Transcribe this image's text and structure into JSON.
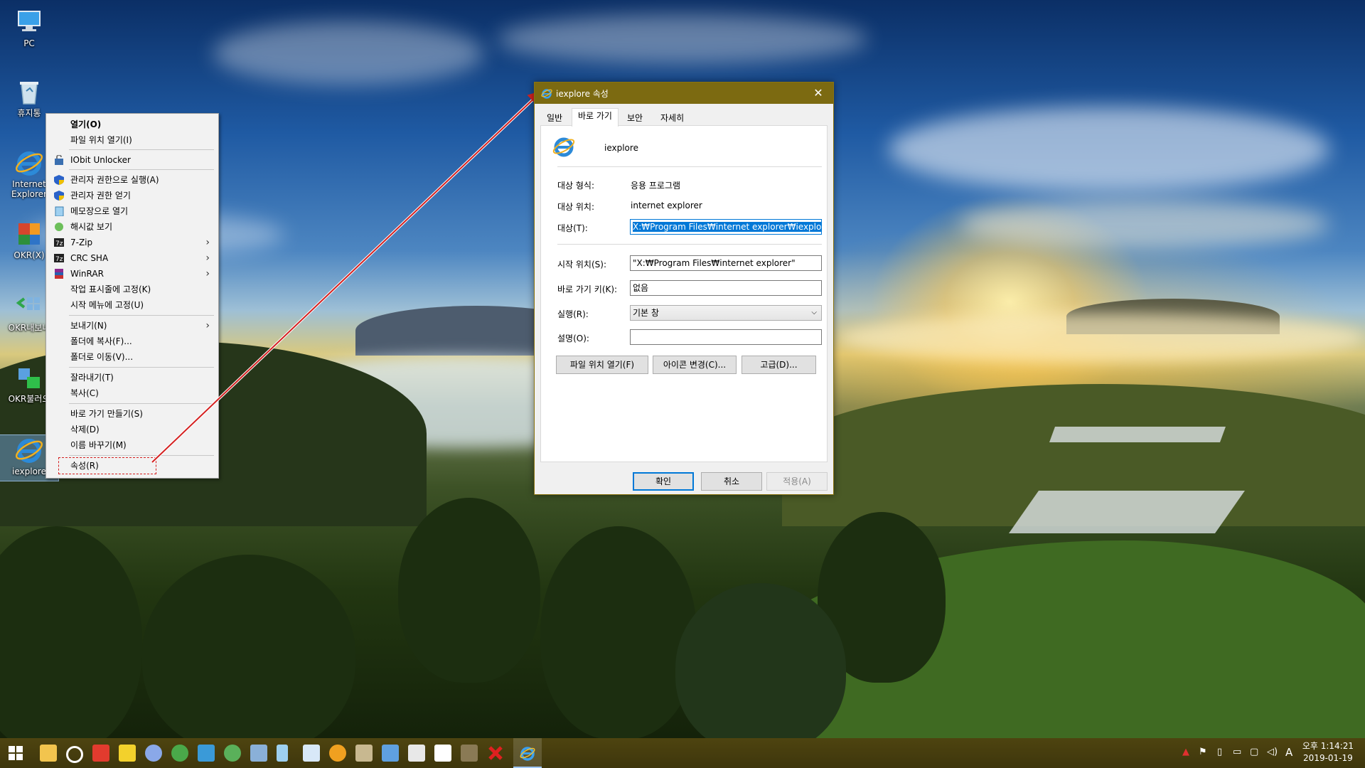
{
  "desktop_icons": [
    {
      "id": "pc",
      "label": "PC",
      "icon": "computer-icon"
    },
    {
      "id": "recycle",
      "label": "휴지통",
      "icon": "recycle-bin-icon"
    },
    {
      "id": "ie",
      "label": "Internet Explorer",
      "icon": "internet-explorer-icon"
    },
    {
      "id": "okrx",
      "label": "OKR(X)",
      "icon": "office-icon"
    },
    {
      "id": "okr_export",
      "label": "OKR내보내",
      "icon": "export-icon"
    },
    {
      "id": "okr_import",
      "label": "OKR불러오",
      "icon": "import-icon"
    },
    {
      "id": "iexplore",
      "label": "iexplore",
      "icon": "internet-explorer-icon"
    }
  ],
  "context_menu": {
    "items": [
      {
        "label": "열기(O)",
        "bold": true
      },
      {
        "label": "파일 위치 열기(I)"
      },
      {
        "label": "IObit Unlocker",
        "icon": "iobit-unlocker-icon"
      },
      {
        "label": "관리자 권한으로 실행(A)",
        "icon": "uac-shield-icon"
      },
      {
        "label": "관리자 권한 얻기",
        "icon": "uac-shield-icon"
      },
      {
        "label": "메모장으로 열기",
        "icon": "notepad-icon"
      },
      {
        "label": "해시값 보기",
        "icon": "hash-icon"
      },
      {
        "label": "7-Zip",
        "icon": "7zip-icon",
        "submenu": true
      },
      {
        "label": "CRC SHA",
        "icon": "7zip-icon",
        "submenu": true
      },
      {
        "label": "WinRAR",
        "icon": "winrar-icon",
        "submenu": true
      },
      {
        "label": "작업 표시줄에 고정(K)"
      },
      {
        "label": "시작 메뉴에 고정(U)"
      },
      {
        "label": "보내기(N)",
        "submenu": true
      },
      {
        "label": "폴더에 복사(F)..."
      },
      {
        "label": "폴더로 이동(V)..."
      },
      {
        "label": "잘라내기(T)"
      },
      {
        "label": "복사(C)"
      },
      {
        "label": "바로 가기 만들기(S)"
      },
      {
        "label": "삭제(D)"
      },
      {
        "label": "이름 바꾸기(M)"
      },
      {
        "label": "속성(R)",
        "highlighted": true
      }
    ]
  },
  "dialog": {
    "title": "iexplore 속성",
    "close": "✕",
    "tabs": [
      "일반",
      "바로 가기",
      "보안",
      "자세히"
    ],
    "active_tab": "바로 가기",
    "name": "iexplore",
    "target_type_label": "대상 형식:",
    "target_type_value": "응용 프로그램",
    "target_location_label": "대상 위치:",
    "target_location_value": "internet explorer",
    "target_label": "대상(T):",
    "target_value": "X:₩Program Files₩internet explorer₩iexplore.exe\"",
    "start_in_label": "시작 위치(S):",
    "start_in_value": "\"X:₩Program Files₩internet explorer\"",
    "shortcut_key_label": "바로 가기 키(K):",
    "shortcut_key_value": "없음",
    "run_label": "실행(R):",
    "run_value": "기본 창",
    "comment_label": "설명(O):",
    "comment_value": "",
    "btn_open_location": "파일 위치 열기(F)",
    "btn_change_icon": "아이콘 변경(C)...",
    "btn_advanced": "고급(D)...",
    "btn_ok": "확인",
    "btn_cancel": "취소",
    "btn_apply": "적용(A)"
  },
  "taskbar": {
    "apps": [
      "start-icon",
      "file-explorer-icon",
      "settings-icon",
      "anydesk-icon",
      "potplayer-icon",
      "browser-icon",
      "chrome-icon",
      "shark-icon",
      "disk-icon",
      "network-icon",
      "document-icon",
      "window-icon",
      "photo-icon",
      "terminal-icon",
      "scissors-icon",
      "console-icon",
      "image-viewer-icon",
      "close-red-icon",
      "internet-explorer-icon"
    ],
    "tray": [
      "network-warning-icon",
      "flag-icon",
      "usb-icon",
      "display-icon",
      "monitor-icon",
      "volume-icon",
      "input-mode-icon"
    ],
    "ime": "A",
    "time": "오후 1:14:21",
    "date": "2019-01-19"
  },
  "colors": {
    "title_bar": "#7c6a11",
    "taskbar": "#463d0e",
    "selection": "#0078d7",
    "annotation": "#d42020"
  }
}
